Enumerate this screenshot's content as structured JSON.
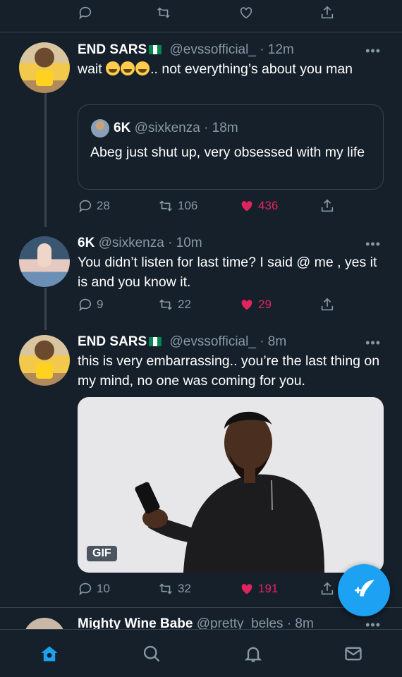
{
  "tweets": [
    {
      "display_name": "END SARS",
      "handle": "@evssofficial_",
      "time": "· 12m",
      "text_prefix": "wait",
      "text_suffix": ".. not everything’s about you man",
      "quote": {
        "display_name": "6K",
        "handle": "@sixkenza",
        "time": "· 18m",
        "text": "Abeg just shut up, very obsessed with my life"
      },
      "replies": "28",
      "retweets": "106",
      "likes": "436"
    },
    {
      "display_name": "6K",
      "handle": "@sixkenza",
      "time": "· 10m",
      "text": "You didn’t listen for last time? I said @ me , yes it is and you know it.",
      "replies": "9",
      "retweets": "22",
      "likes": "29"
    },
    {
      "display_name": "END SARS",
      "handle": "@evssofficial_",
      "time": "· 8m",
      "text": "this is very embarrassing.. you’re the last thing on my mind, no one was coming for you.",
      "gif_label": "GIF",
      "replies": "10",
      "retweets": "32",
      "likes": "191"
    },
    {
      "display_name": "Mighty Wine Babe",
      "handle": "@pretty_beles",
      "time": "· 8m"
    }
  ],
  "more_glyph": "•••",
  "colors": {
    "background": "#15202b",
    "accent": "#1da1f2",
    "like": "#e0245e",
    "muted": "#8899a6"
  },
  "icons": [
    "reply-icon",
    "retweet-icon",
    "like-icon",
    "share-icon",
    "compose-icon",
    "home-icon",
    "search-icon",
    "notifications-icon",
    "messages-icon"
  ]
}
